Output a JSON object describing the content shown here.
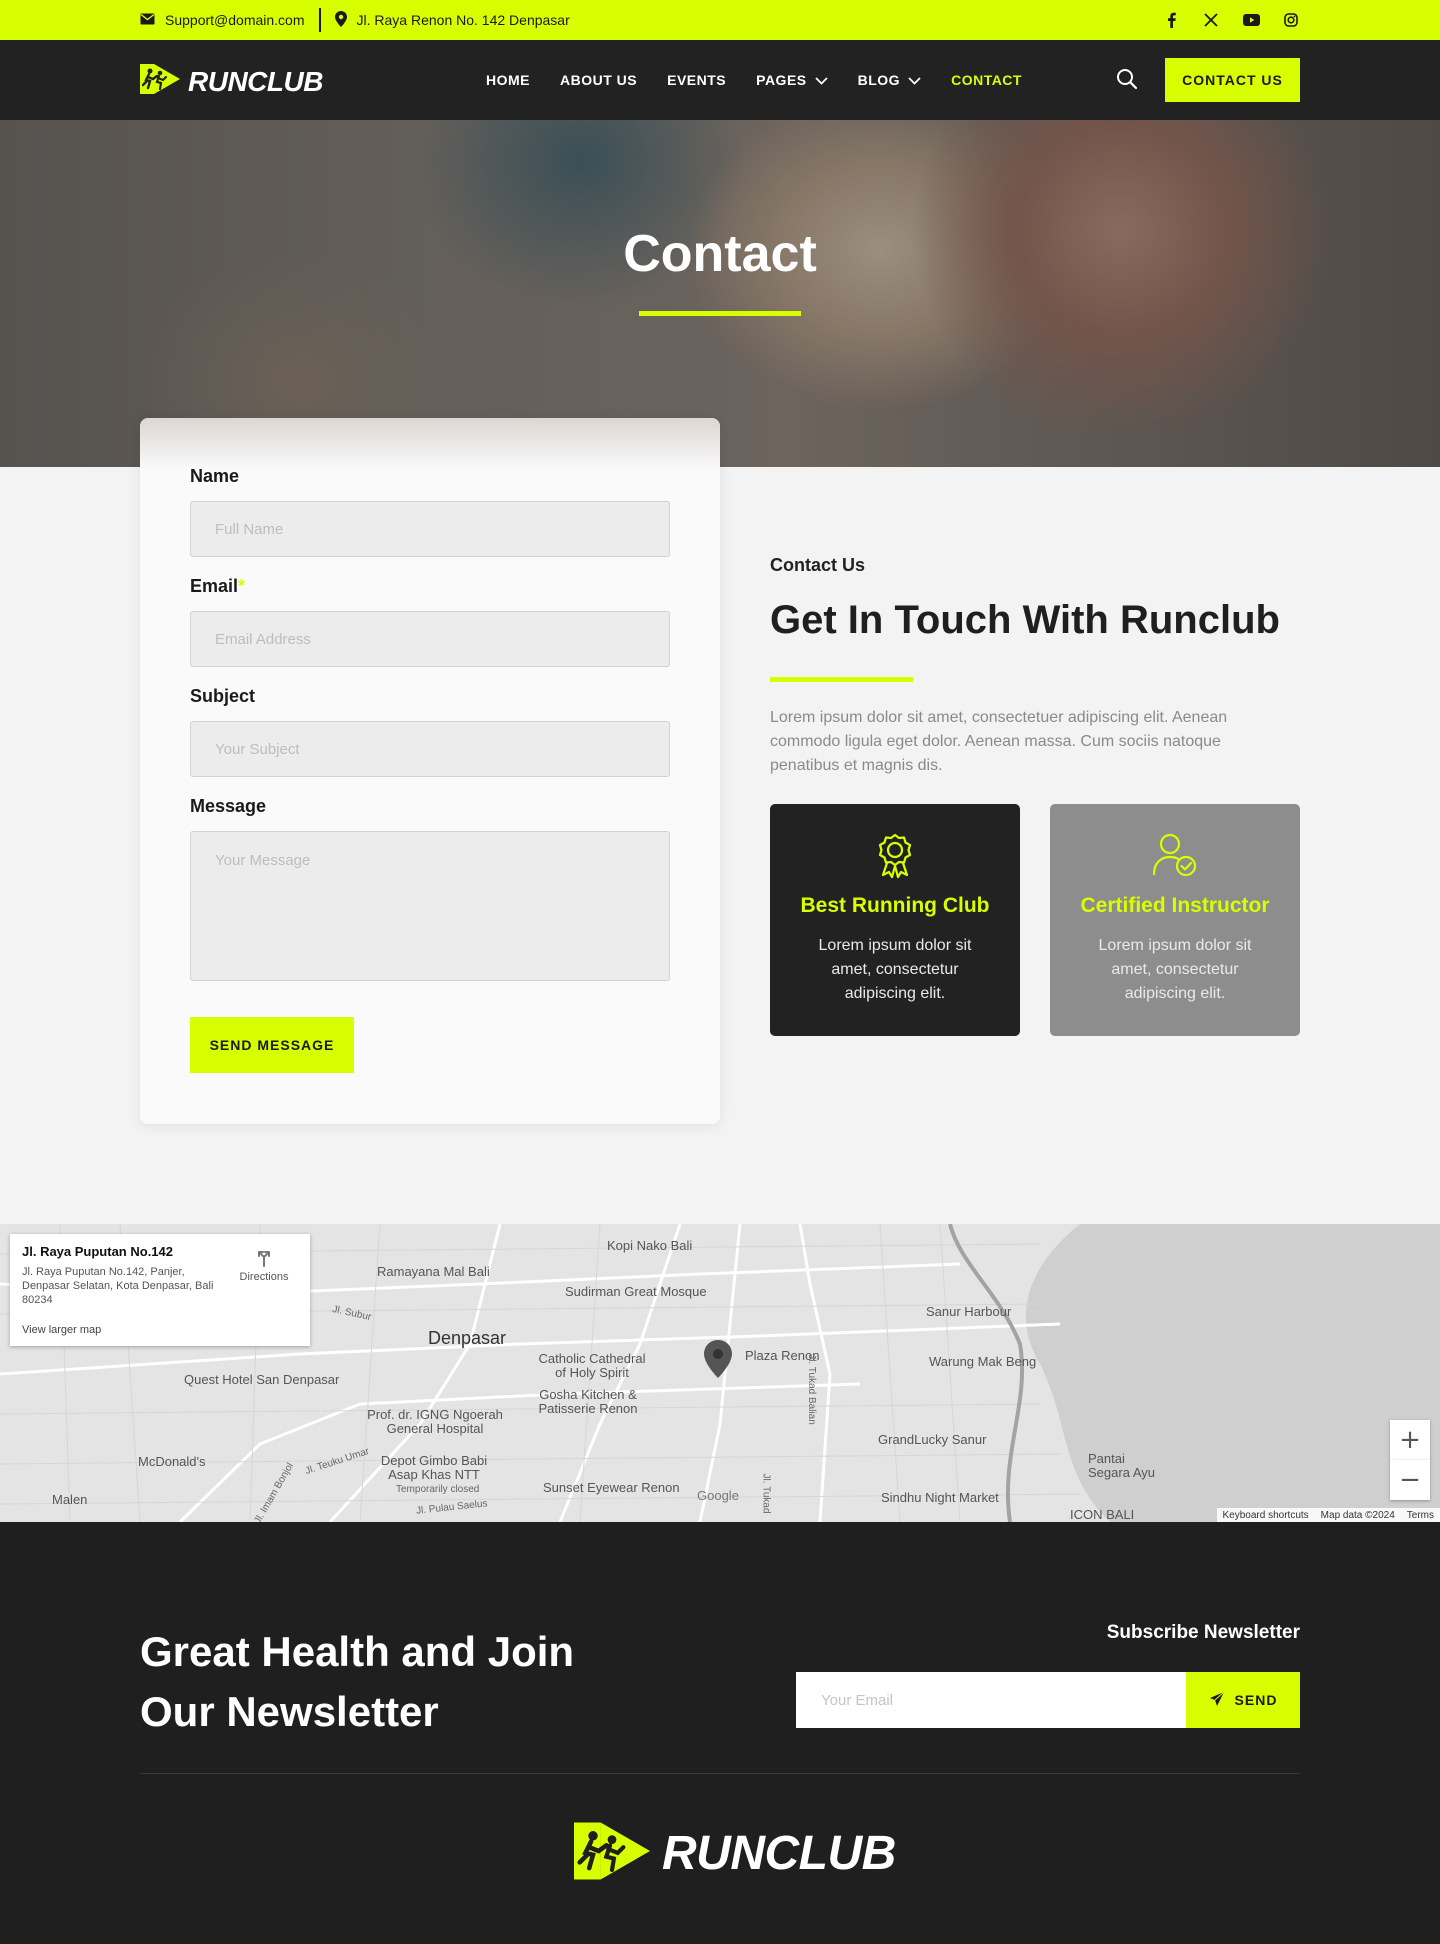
{
  "topbar": {
    "email": "Support@domain.com",
    "address": "Jl. Raya Renon No. 142 Denpasar",
    "social": [
      "facebook-icon",
      "x-icon",
      "youtube-icon",
      "instagram-icon"
    ]
  },
  "nav": {
    "brand": "RUNCLUB",
    "items": [
      {
        "label": "HOME"
      },
      {
        "label": "ABOUT US"
      },
      {
        "label": "EVENTS"
      },
      {
        "label": "PAGES",
        "dropdown": true
      },
      {
        "label": "BLOG",
        "dropdown": true
      },
      {
        "label": "CONTACT",
        "active": true
      }
    ],
    "cta": "CONTACT US"
  },
  "hero": {
    "title": "Contact"
  },
  "form": {
    "name_label": "Name",
    "name_placeholder": "Full Name",
    "email_label": "Email",
    "email_required": "*",
    "email_placeholder": "Email Address",
    "subject_label": "Subject",
    "subject_placeholder": "Your Subject",
    "message_label": "Message",
    "message_placeholder": "Your Message",
    "submit": "SEND MESSAGE"
  },
  "contact": {
    "eyebrow": "Contact Us",
    "title": "Get In Touch With Runclub",
    "description": "Lorem ipsum dolor sit amet, consectetuer adipiscing elit. Aenean commodo ligula eget dolor. Aenean massa. Cum sociis natoque penatibus et magnis dis.",
    "features": [
      {
        "title": "Best Running Club",
        "desc": "Lorem ipsum dolor sit amet, consectetur adipiscing elit.",
        "icon": "award-icon"
      },
      {
        "title": "Certified Instructor",
        "desc": "Lorem ipsum dolor sit amet, consectetur adipiscing elit.",
        "icon": "user-check-icon"
      }
    ]
  },
  "map": {
    "info_title": "Jl. Raya Puputan No.142",
    "info_address": "Jl. Raya Puputan No.142, Panjer, Denpasar Selatan, Kota Denpasar, Bali 80234",
    "info_link": "View larger map",
    "directions": "Directions",
    "labels": {
      "denpasar": "Denpasar",
      "kopi": "Kopi Nako Bali",
      "ramayana": "Ramayana Mal Bali",
      "sudirman": "Sudirman Great Mosque",
      "sanur": "Sanur Harbour",
      "warung": "Warung Mak Beng",
      "plaza": "Plaza Renon",
      "cathedral": "Catholic Cathedral of Holy Spirit",
      "gosha": "Gosha Kitchen & Patisserie Renon",
      "quest": "Quest Hotel San Denpasar",
      "hospital": "Prof. dr. IGNG Ngoerah General Hospital",
      "mcd": "McDonald's",
      "depot": "Depot Gimbo Babi Asap Khas NTT",
      "depot_note": "Temporarily closed",
      "sunset": "Sunset Eyewear Renon",
      "grandlucky": "GrandLucky Sanur",
      "pantai": "Pantai Segara Ayu",
      "sindhu": "Sindhu Night Market",
      "icon": "ICON BALI",
      "malen": "Malen",
      "subur": "Jl. Subur",
      "teuku": "Jl. Teuku Umar",
      "pulau": "Jl. Pulau Saelus",
      "tukad_bal": "Jl. Tukad Balian",
      "tukad": "Jl. Tukad",
      "bonjol": "Jl. Imam Bonjol",
      "google": "Google"
    },
    "zoom_in": "+",
    "zoom_out": "−",
    "attribution": [
      "Keyboard shortcuts",
      "Map data ©2024",
      "Terms"
    ]
  },
  "footer": {
    "newsletter_title": "Great Health and Join Our Newsletter",
    "newsletter_label": "Subscribe Newsletter",
    "email_placeholder": "Your Email",
    "send": "SEND",
    "brand": "RUNCLUB"
  },
  "colors": {
    "accent": "#d8ff00",
    "dark": "#222222",
    "feature_gray": "#8d8d8d",
    "footer": "#1f1f1f"
  }
}
